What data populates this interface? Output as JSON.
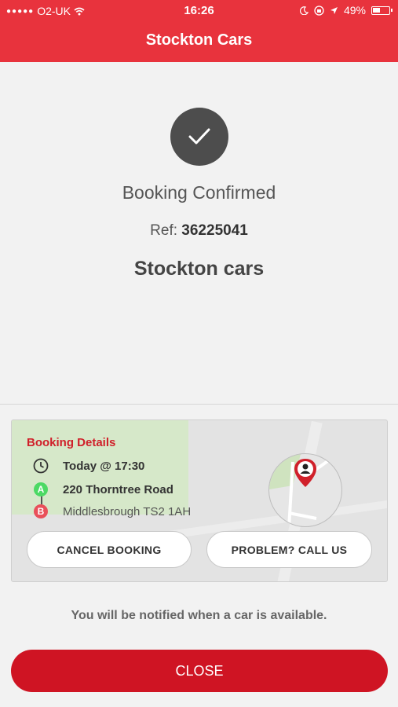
{
  "status_bar": {
    "carrier": "O2-UK",
    "time": "16:26",
    "battery_percent": "49%",
    "battery_level": 0.49
  },
  "header": {
    "title": "Stockton Cars"
  },
  "confirmation": {
    "title": "Booking Confirmed",
    "ref_label": "Ref:",
    "ref_value": "36225041",
    "company": "Stockton cars"
  },
  "booking": {
    "title": "Booking Details",
    "time": "Today @ 17:30",
    "pickup_marker": "A",
    "pickup": "220 Thorntree Road",
    "dropoff_marker": "B",
    "dropoff": "Middlesbrough TS2 1AH",
    "cancel_label": "CANCEL BOOKING",
    "call_label": "PROBLEM? CALL US"
  },
  "notice": "You will be notified when a car is available.",
  "close_label": "CLOSE",
  "colors": {
    "brand_red": "#e8333d",
    "close_red": "#cf1423",
    "heading_red": "#d0202a"
  }
}
